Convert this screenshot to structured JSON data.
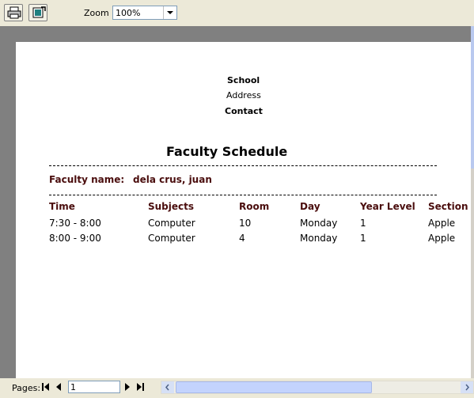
{
  "toolbar": {
    "print_icon": "printer-icon",
    "export_icon": "export-icon",
    "zoom_label": "Zoom",
    "zoom_value": "100%"
  },
  "report": {
    "school": "School",
    "address": "Address",
    "contact": "Contact",
    "title": "Faculty Schedule",
    "faculty_name_label": "Faculty name:",
    "faculty_name_value": "dela crus, juan",
    "columns": [
      "Time",
      "Subjects",
      "Room",
      "Day",
      "Year Level",
      "Section"
    ],
    "rows": [
      [
        "7:30 - 8:00",
        "Computer",
        "10",
        "Monday",
        "1",
        "Apple"
      ],
      [
        "8:00 - 9:00",
        "Computer",
        "4",
        "Monday",
        "1",
        "Apple"
      ]
    ]
  },
  "statusbar": {
    "pages_label": "Pages:",
    "page_value": "1"
  }
}
